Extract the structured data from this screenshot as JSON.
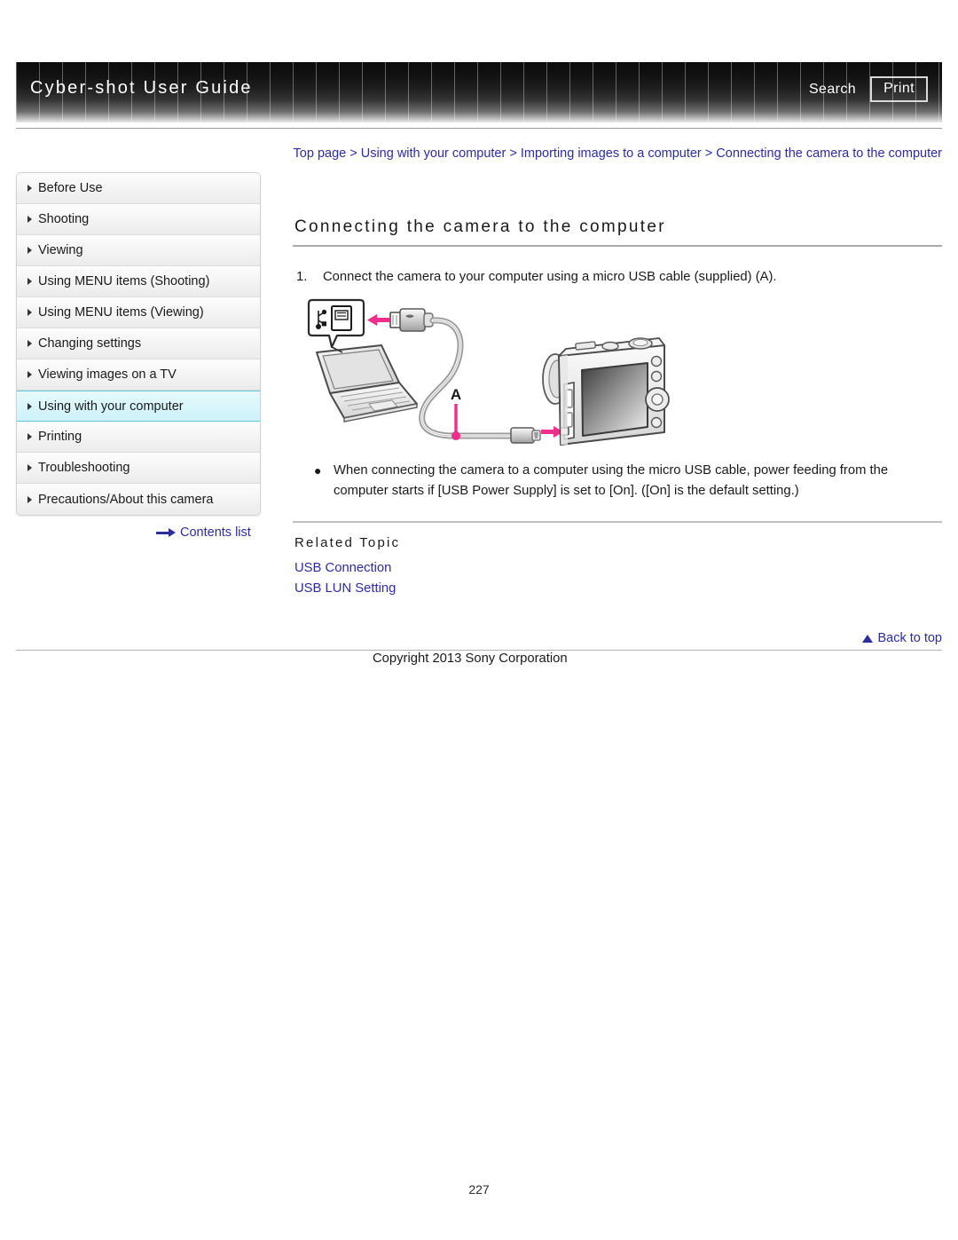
{
  "header": {
    "title": "Cyber-shot User Guide",
    "search_label": "Search",
    "print_label": "Print"
  },
  "breadcrumb": {
    "items": [
      "Top page",
      "Using with your computer",
      "Importing images to a computer",
      "Connecting the camera to the computer"
    ],
    "separator": ">"
  },
  "sidebar": {
    "items": [
      {
        "label": "Before Use",
        "active": false
      },
      {
        "label": "Shooting",
        "active": false
      },
      {
        "label": "Viewing",
        "active": false
      },
      {
        "label": "Using MENU items (Shooting)",
        "active": false
      },
      {
        "label": "Using MENU items (Viewing)",
        "active": false
      },
      {
        "label": "Changing settings",
        "active": false
      },
      {
        "label": "Viewing images on a TV",
        "active": false
      },
      {
        "label": "Using with your computer",
        "active": true
      },
      {
        "label": "Printing",
        "active": false
      },
      {
        "label": "Troubleshooting",
        "active": false
      },
      {
        "label": "Precautions/About this camera",
        "active": false
      }
    ],
    "contents_list_label": "Contents list"
  },
  "main": {
    "heading": "Connecting the camera to the computer",
    "step_number": "1.",
    "step_text": "Connect the camera to your computer using a micro USB cable (supplied) (A).",
    "figure_callout_label": "A",
    "bullet_marker": "●",
    "bullet_text": "When connecting the camera to a computer using the micro USB cable, power feeding from the computer starts if [USB Power Supply] is set to [On]. ([On] is the default setting.)",
    "related_heading": "Related Topic",
    "related_links": [
      "USB Connection",
      "USB LUN Setting"
    ]
  },
  "footer": {
    "back_to_top_label": "Back to top",
    "copyright": "Copyright 2013 Sony Corporation",
    "page_number": "227"
  },
  "colors": {
    "link": "#2d2d9e",
    "accent_magenta": "#ef2d8b",
    "active_nav_bg": "#d8f6fb",
    "active_nav_border": "#5fc8da"
  }
}
